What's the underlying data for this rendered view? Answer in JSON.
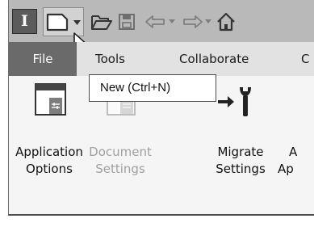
{
  "qat": {
    "app_icon_letter": "I"
  },
  "ribbon": {
    "tabs": [
      "File",
      "Tools",
      "Collaborate",
      "C"
    ]
  },
  "tooltip": {
    "text": "New (Ctrl+N)"
  },
  "commands": [
    {
      "line1": "Application",
      "line2": "Options"
    },
    {
      "line1": "Document",
      "line2": "Settings"
    },
    {
      "line1": "Migrate",
      "line2": "Settings"
    },
    {
      "line1": "A",
      "line2": "Ap"
    }
  ],
  "colors": {
    "qat_bg": "#b9b9b9",
    "file_tab_bg": "#6a6a6a",
    "app_icon_bg": "#5b5b5b"
  }
}
